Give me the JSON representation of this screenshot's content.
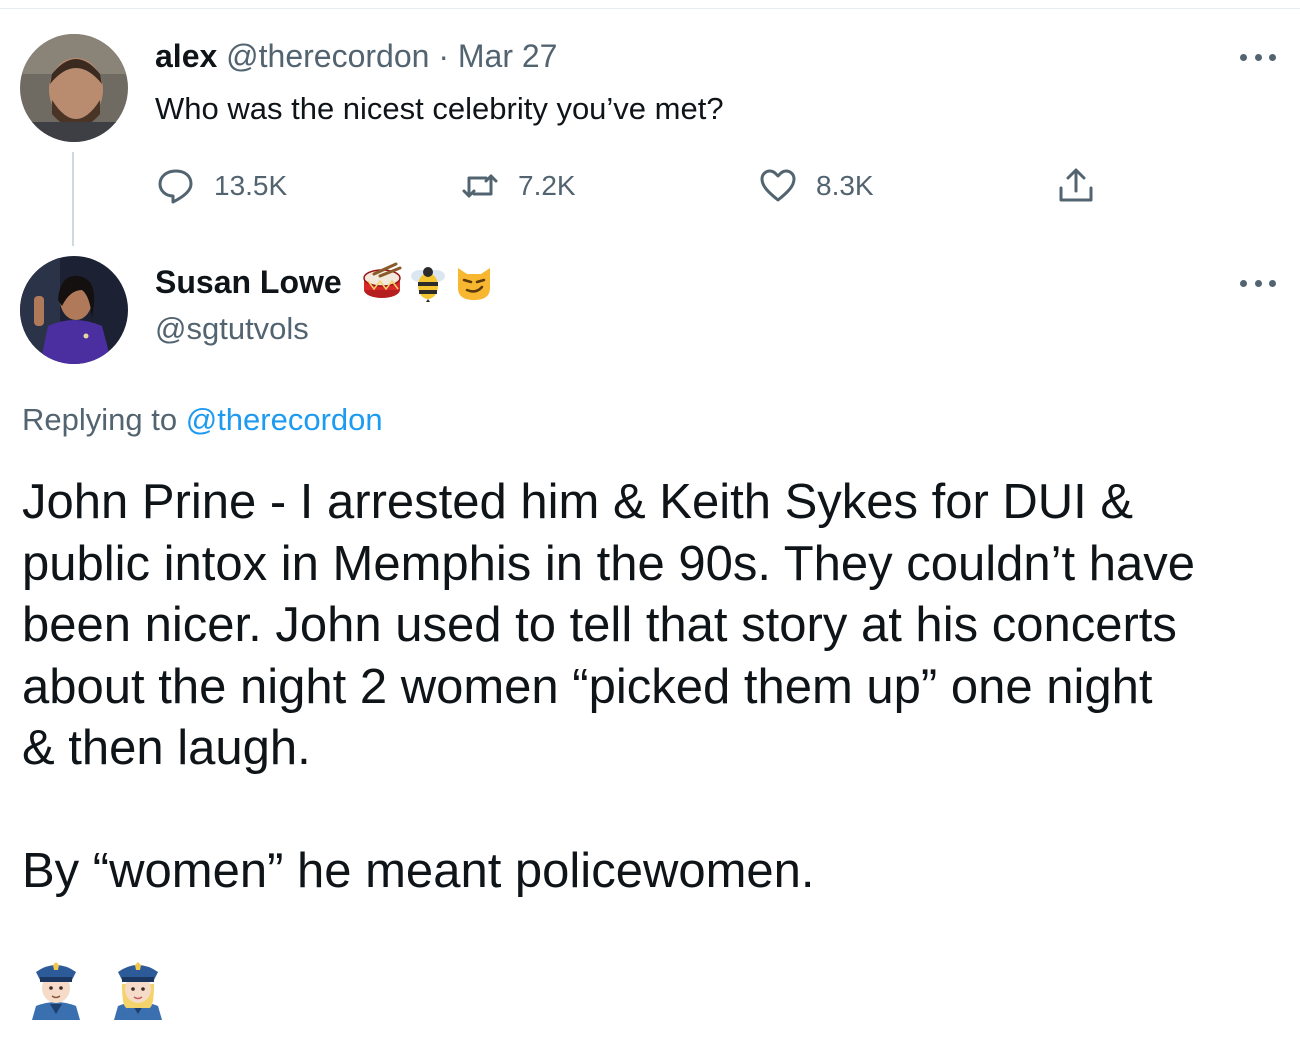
{
  "tweet1": {
    "display_name": "alex",
    "handle": "@therecordon",
    "separator": "·",
    "date": "Mar 27",
    "text": "Who was the nicest celebrity you’ve met?",
    "actions": {
      "reply": {
        "icon": "reply-icon",
        "count": "13.5K"
      },
      "retweet": {
        "icon": "retweet-icon",
        "count": "7.2K"
      },
      "like": {
        "icon": "heart-icon",
        "count": "8.3K"
      },
      "share": {
        "icon": "share-icon"
      }
    }
  },
  "tweet2": {
    "display_name": "Susan Lowe",
    "name_emojis": [
      "drum-emoji",
      "bee-emoji",
      "smirking-cat-emoji"
    ],
    "handle": "@sgtutvols",
    "replying_prefix": "Replying to",
    "replying_handle": "@therecordon",
    "lines": [
      "John Prine - I arrested him & Keith Sykes for DUI &",
      "public intox in Memphis in the 90s. They couldn’t have",
      "been nicer. John used to tell that story at  his concerts",
      "about the night 2 women “picked them up” one night",
      "& then laugh."
    ],
    "closing": "By “women” he meant policewomen.",
    "trailing_emojis": [
      "police-officer-emoji",
      "policewoman-emoji"
    ]
  },
  "colors": {
    "text": "#0f1419",
    "muted": "#536471",
    "link": "#1d9bf0",
    "divider": "#e6ecf0"
  }
}
